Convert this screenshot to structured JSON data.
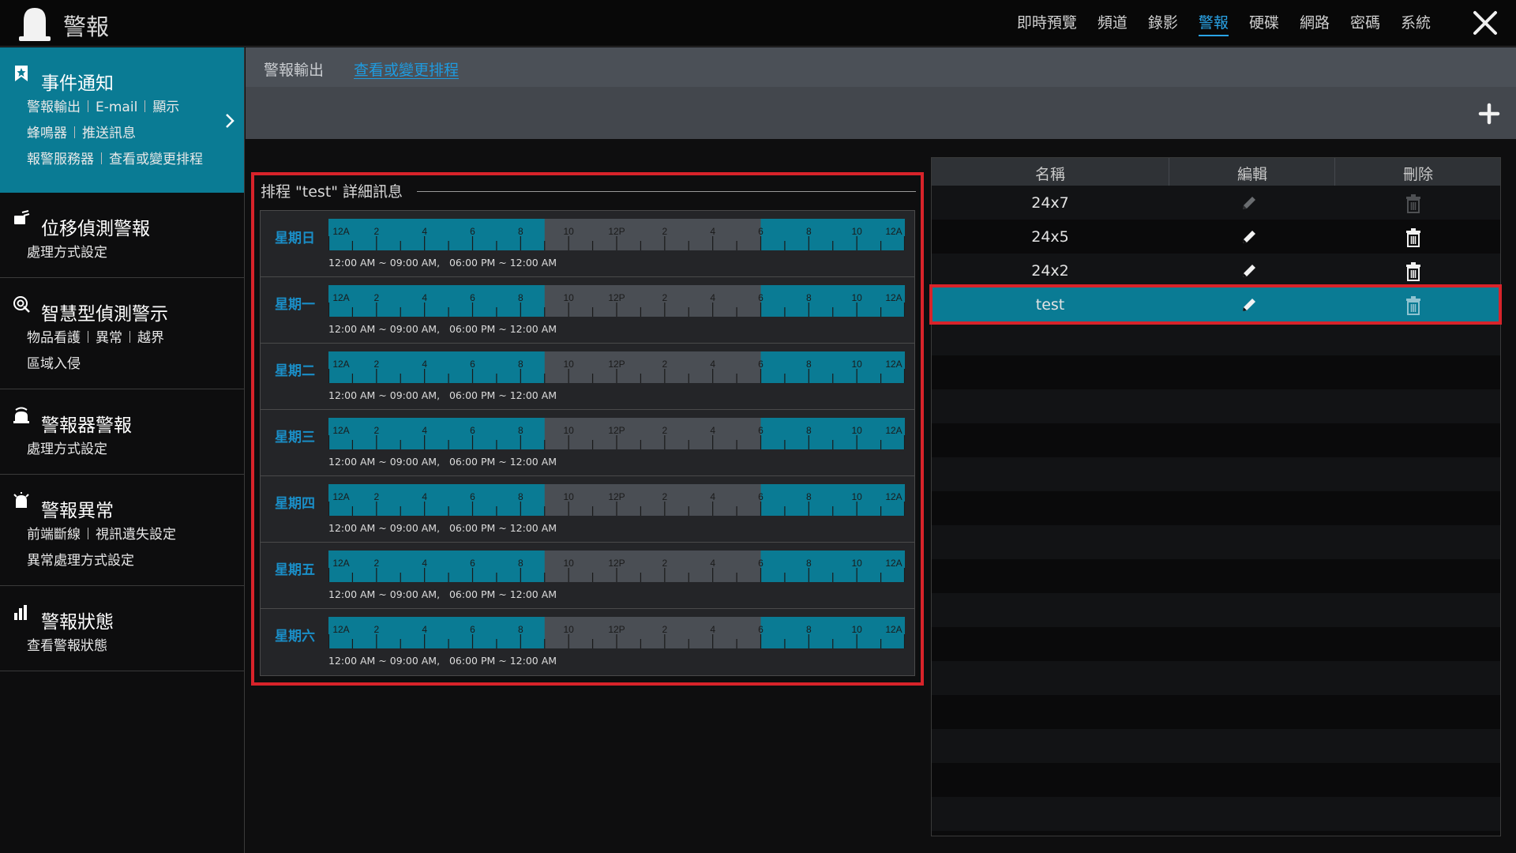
{
  "app": {
    "title": "警報"
  },
  "topnav": [
    "即時預覽",
    "頻道",
    "錄影",
    "警報",
    "硬碟",
    "網路",
    "密碼",
    "系統"
  ],
  "topnav_active": "警報",
  "sidebar": [
    {
      "title": "事件通知",
      "icon": "bookmark-star-icon",
      "active": true,
      "rows": [
        [
          "警報輸出",
          "E-mail",
          "顯示"
        ],
        [
          "蜂鳴器",
          "推送訊息"
        ],
        [
          "報警服務器",
          "查看或變更排程"
        ]
      ]
    },
    {
      "title": "位移偵測警報",
      "icon": "motion-detect-icon",
      "active": false,
      "rows": [
        [
          "處理方式設定"
        ]
      ]
    },
    {
      "title": "智慧型偵測警示",
      "icon": "smart-detect-icon",
      "active": false,
      "rows": [
        [
          "物品看護",
          "異常",
          "越界"
        ],
        [
          "區域入侵"
        ]
      ]
    },
    {
      "title": "警報器警報",
      "icon": "alarm-sensor-icon",
      "active": false,
      "rows": [
        [
          "處理方式設定"
        ]
      ]
    },
    {
      "title": "警報異常",
      "icon": "alarm-exception-icon",
      "active": false,
      "rows": [
        [
          "前端斷線",
          "視訊遺失設定"
        ],
        [
          "異常處理方式設定"
        ]
      ]
    },
    {
      "title": "警報狀態",
      "icon": "alarm-status-icon",
      "active": false,
      "rows": [
        [
          "查看警報狀態"
        ]
      ]
    }
  ],
  "tabs": {
    "output": "警報輸出",
    "schedule": "查看或變更排程"
  },
  "schedule": {
    "title": "排程 \"test\" 詳細訊息",
    "tick_labels": [
      "12A",
      "2",
      "4",
      "6",
      "8",
      "10",
      "12P",
      "2",
      "4",
      "6",
      "8",
      "10",
      "12A"
    ],
    "days": [
      {
        "label": "星期日",
        "desc": "12:00 AM ~ 09:00 AM,   06:00 PM ~ 12:00 AM"
      },
      {
        "label": "星期一",
        "desc": "12:00 AM ~ 09:00 AM,   06:00 PM ~ 12:00 AM"
      },
      {
        "label": "星期二",
        "desc": "12:00 AM ~ 09:00 AM,   06:00 PM ~ 12:00 AM"
      },
      {
        "label": "星期三",
        "desc": "12:00 AM ~ 09:00 AM,   06:00 PM ~ 12:00 AM"
      },
      {
        "label": "星期四",
        "desc": "12:00 AM ~ 09:00 AM,   06:00 PM ~ 12:00 AM"
      },
      {
        "label": "星期五",
        "desc": "12:00 AM ~ 09:00 AM,   06:00 PM ~ 12:00 AM"
      },
      {
        "label": "星期六",
        "desc": "12:00 AM ~ 09:00 AM,   06:00 PM ~ 12:00 AM"
      }
    ],
    "active_ranges_hours": [
      [
        0,
        9
      ],
      [
        18,
        24
      ]
    ]
  },
  "list": {
    "headers": {
      "name": "名稱",
      "edit": "編輯",
      "delete": "刪除"
    },
    "rows": [
      {
        "name": "24x7",
        "editable": false,
        "deletable": false,
        "selected": false
      },
      {
        "name": "24x5",
        "editable": true,
        "deletable": true,
        "selected": false
      },
      {
        "name": "24x2",
        "editable": true,
        "deletable": true,
        "selected": false
      },
      {
        "name": "test",
        "editable": true,
        "deletable": true,
        "selected": true
      }
    ]
  },
  "colors": {
    "accent": "#0a7b94",
    "active_blue": "#1e9be0",
    "schedule_on": "#0a7b94",
    "schedule_off": "#4a4e54",
    "highlight_red": "#d8232a"
  }
}
